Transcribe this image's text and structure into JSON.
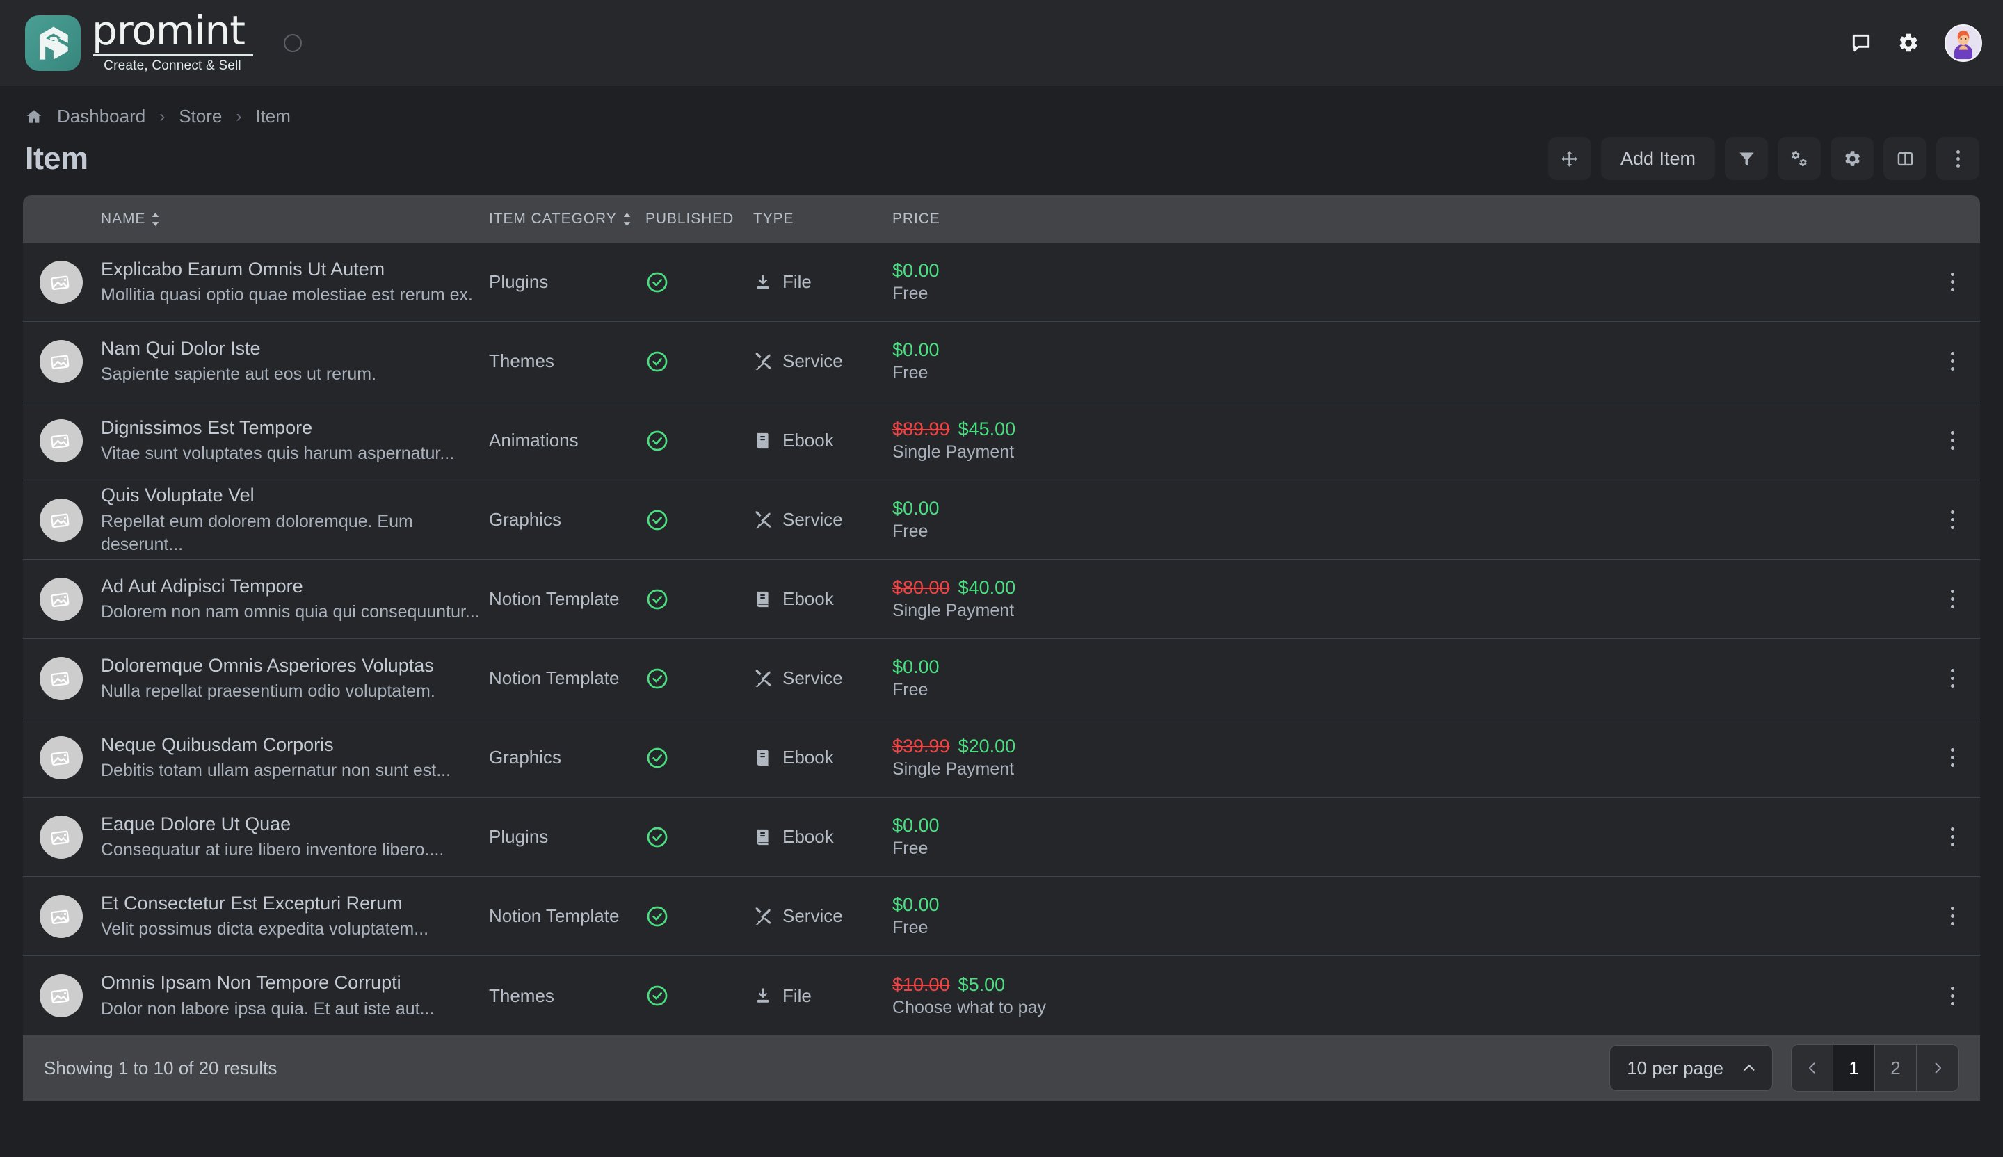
{
  "brand": {
    "name": "promint",
    "tagline": "Create, Connect & Sell",
    "logo_color": "#3f9187"
  },
  "topbar": {
    "icons": [
      {
        "name": "chat-icon",
        "label": "Messages"
      },
      {
        "name": "gear-icon",
        "label": "Settings"
      },
      {
        "name": "avatar",
        "label": "User profile"
      }
    ]
  },
  "breadcrumb": {
    "home_label": "Home",
    "items": [
      "Dashboard",
      "Store",
      "Item"
    ],
    "separator": "›"
  },
  "page": {
    "title": "Item"
  },
  "toolbar": {
    "reorder_label": "Reorder",
    "add_label": "Add Item",
    "filter_label": "Filter",
    "bulk_settings_label": "Bulk settings",
    "settings_label": "Settings",
    "columns_label": "Columns",
    "more_label": "More actions"
  },
  "table": {
    "columns": [
      {
        "key": "name",
        "label": "NAME",
        "sortable": true
      },
      {
        "key": "category",
        "label": "ITEM CATEGORY",
        "sortable": true
      },
      {
        "key": "published",
        "label": "PUBLISHED",
        "sortable": false
      },
      {
        "key": "type",
        "label": "TYPE",
        "sortable": false
      },
      {
        "key": "price",
        "label": "PRICE",
        "sortable": false
      }
    ],
    "rows": [
      {
        "name": "Explicabo Earum Omnis Ut Autem",
        "description": "Mollitia quasi optio quae molestiae est rerum ex.",
        "category": "Plugins",
        "published": true,
        "type": "File",
        "type_icon": "download-icon",
        "price_old": "",
        "price": "$0.00",
        "price_note": "Free"
      },
      {
        "name": "Nam Qui Dolor Iste",
        "description": "Sapiente sapiente aut eos ut rerum.",
        "category": "Themes",
        "published": true,
        "type": "Service",
        "type_icon": "tools-icon",
        "price_old": "",
        "price": "$0.00",
        "price_note": "Free"
      },
      {
        "name": "Dignissimos Est Tempore",
        "description": "Vitae sunt voluptates quis harum aspernatur...",
        "category": "Animations",
        "published": true,
        "type": "Ebook",
        "type_icon": "book-icon",
        "price_old": "$89.99",
        "price": "$45.00",
        "price_note": "Single Payment"
      },
      {
        "name": "Quis Voluptate Vel",
        "description": "Repellat eum dolorem doloremque. Eum deserunt...",
        "category": "Graphics",
        "published": true,
        "type": "Service",
        "type_icon": "tools-icon",
        "price_old": "",
        "price": "$0.00",
        "price_note": "Free"
      },
      {
        "name": "Ad Aut Adipisci Tempore",
        "description": "Dolorem non nam omnis quia qui consequuntur...",
        "category": "Notion Template",
        "published": true,
        "type": "Ebook",
        "type_icon": "book-icon",
        "price_old": "$80.00",
        "price": "$40.00",
        "price_note": "Single Payment"
      },
      {
        "name": "Doloremque Omnis Asperiores Voluptas",
        "description": "Nulla repellat praesentium odio voluptatem.",
        "category": "Notion Template",
        "published": true,
        "type": "Service",
        "type_icon": "tools-icon",
        "price_old": "",
        "price": "$0.00",
        "price_note": "Free"
      },
      {
        "name": "Neque Quibusdam Corporis",
        "description": "Debitis totam ullam aspernatur non sunt est...",
        "category": "Graphics",
        "published": true,
        "type": "Ebook",
        "type_icon": "book-icon",
        "price_old": "$39.99",
        "price": "$20.00",
        "price_note": "Single Payment"
      },
      {
        "name": "Eaque Dolore Ut Quae",
        "description": "Consequatur at iure libero inventore libero....",
        "category": "Plugins",
        "published": true,
        "type": "Ebook",
        "type_icon": "book-icon",
        "price_old": "",
        "price": "$0.00",
        "price_note": "Free"
      },
      {
        "name": "Et Consectetur Est Excepturi Rerum",
        "description": "Velit possimus dicta expedita voluptatem...",
        "category": "Notion Template",
        "published": true,
        "type": "Service",
        "type_icon": "tools-icon",
        "price_old": "",
        "price": "$0.00",
        "price_note": "Free"
      },
      {
        "name": "Omnis Ipsam Non Tempore Corrupti",
        "description": "Dolor non labore ipsa quia. Et aut iste aut...",
        "category": "Themes",
        "published": true,
        "type": "File",
        "type_icon": "download-icon",
        "price_old": "$10.00",
        "price": "$5.00",
        "price_note": "Choose what to pay"
      }
    ]
  },
  "footer": {
    "showing": "Showing 1 to 10 of 20 results",
    "per_page": "10 per page",
    "pages": [
      "1",
      "2"
    ],
    "active_page": "1",
    "prev_label": "Previous page",
    "next_label": "Next page"
  },
  "colors": {
    "accent_green": "#4ade80",
    "strike_red": "#ef4444",
    "brand_teal": "#3f9187",
    "surface": "#242629",
    "header_surface": "#424447"
  }
}
